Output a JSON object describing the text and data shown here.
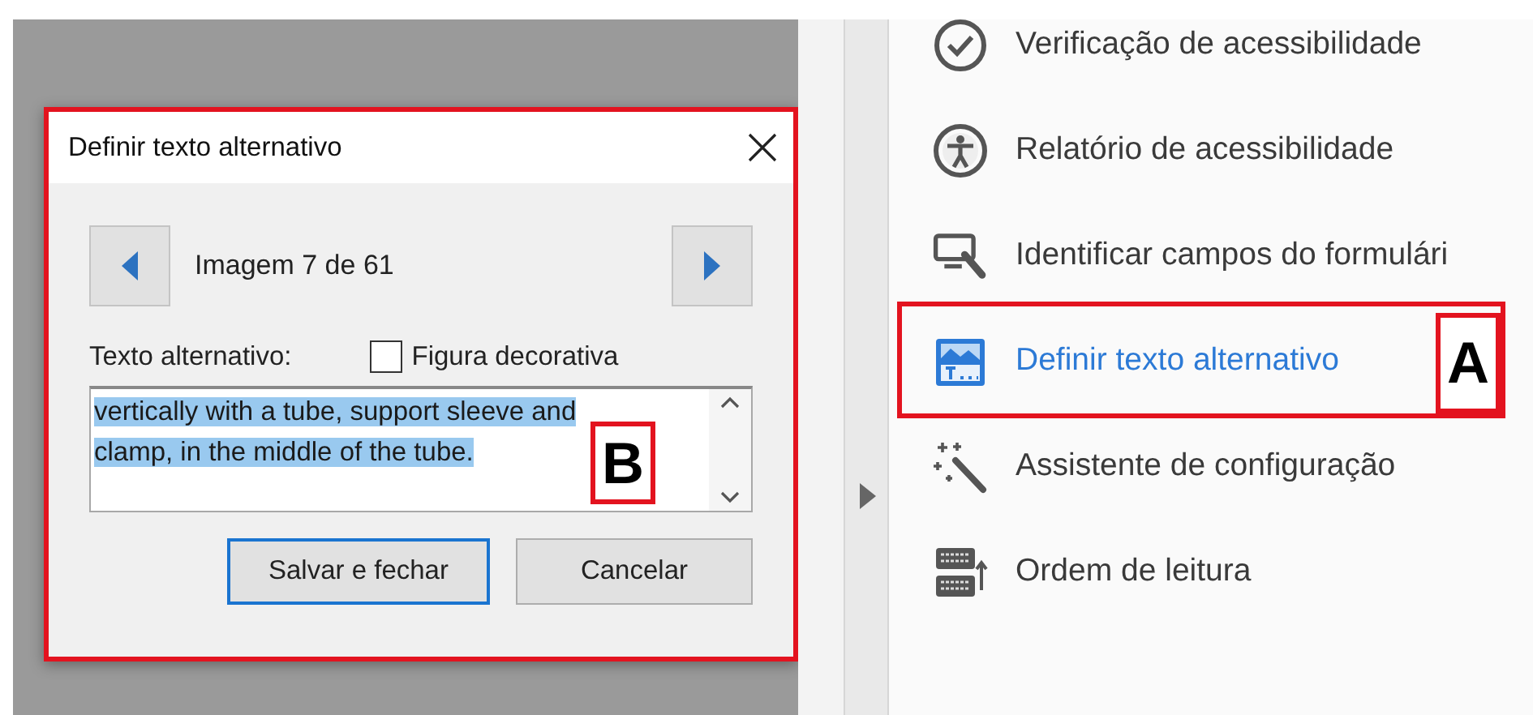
{
  "dialog": {
    "title": "Definir texto alternativo",
    "outlined": true,
    "counter": "Imagem 7 de 61",
    "alt_text_label": "Texto alternativo:",
    "decorative": {
      "label": "Figura decorativa",
      "checked": false
    },
    "alt_text": {
      "value": "vertically with a tube, support sleeve and clamp, in the middle of the tube.",
      "selected": true,
      "callout": "B"
    },
    "buttons": [
      {
        "label": "Salvar e fechar",
        "default": true
      },
      {
        "label": "Cancelar",
        "default": false
      }
    ]
  },
  "panel": {
    "items": [
      {
        "label": "Verificação de acessibilidade",
        "selected": false
      },
      {
        "label": "Relatório de acessibilidade",
        "selected": false
      },
      {
        "label": "Identificar campos do formulári",
        "selected": false
      },
      {
        "label": "Definir texto alternativo",
        "selected": true,
        "callout": "A"
      },
      {
        "label": "Assistente de configuração",
        "selected": false
      },
      {
        "label": "Ordem de leitura",
        "selected": false
      }
    ]
  }
}
